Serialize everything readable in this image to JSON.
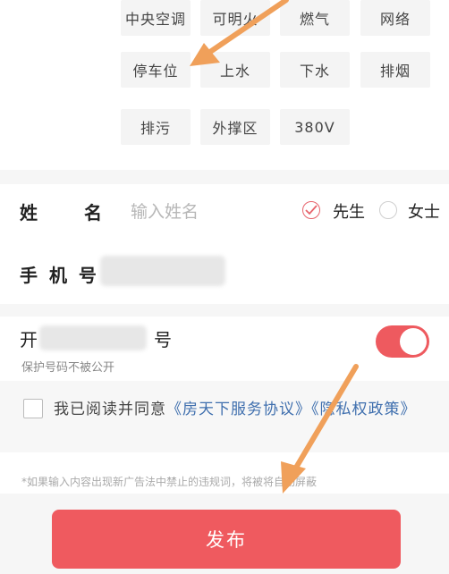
{
  "facilities": [
    {
      "label": "中央空调"
    },
    {
      "label": "可明火"
    },
    {
      "label": "燃气"
    },
    {
      "label": "网络"
    },
    {
      "label": "停车位"
    },
    {
      "label": "上水"
    },
    {
      "label": "下水"
    },
    {
      "label": "排烟"
    },
    {
      "label": "排污"
    },
    {
      "label": "外撑区"
    },
    {
      "label": "380V"
    }
  ],
  "contact": {
    "name_label": "姓　　名",
    "name_placeholder": "输入姓名",
    "gender_options": [
      {
        "label": "先生",
        "selected": true
      },
      {
        "label": "女士",
        "selected": false
      }
    ],
    "phone_label": "手 机 号"
  },
  "privacy": {
    "title_prefix": "开",
    "title_suffix": "号",
    "subtitle": "保护号码不被公开",
    "enabled": true
  },
  "agreement": {
    "prefix": "我已阅读并同意",
    "link1": "《房天下服务协议》",
    "link2": "《隐私权政策》",
    "checked": false
  },
  "notice": "*如果输入内容出现新广告法中禁止的违规词，将被将自动屏蔽",
  "publish_label": "发布",
  "colors": {
    "accent": "#ef5a5f",
    "link": "#3f6fae",
    "arrow": "#f0a05a"
  }
}
